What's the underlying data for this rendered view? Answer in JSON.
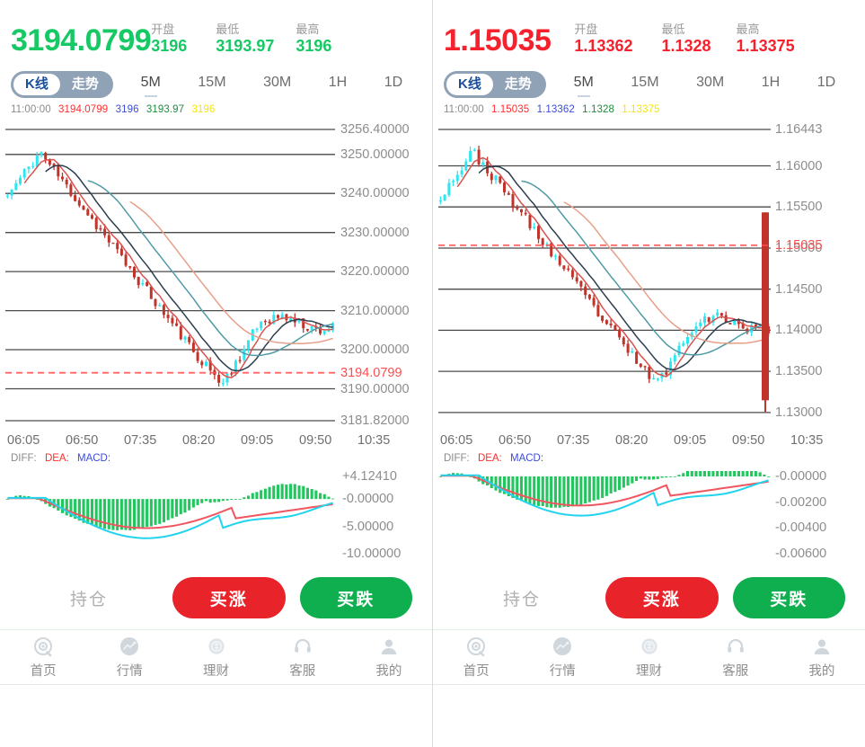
{
  "panels": [
    {
      "id": "left",
      "direction": "up",
      "last_price": "3194.0799",
      "stats": [
        {
          "label": "开盘",
          "value": "3196"
        },
        {
          "label": "最低",
          "value": "3193.97"
        },
        {
          "label": "最高",
          "value": "3196"
        }
      ],
      "segment": {
        "kline": "K线",
        "trend": "走势",
        "active": "K线"
      },
      "timeframes": [
        "5M",
        "15M",
        "30M",
        "1H",
        "1D"
      ],
      "active_timeframe": "5M",
      "ohlc": {
        "time": "11:00:00",
        "close": "3194.0799",
        "open": "3196",
        "low": "3193.97",
        "high": "3196"
      },
      "chart_data": {
        "type": "line",
        "title": "",
        "xlabel": "",
        "ylabel": "",
        "ylim": [
          3181.82,
          3256.4
        ],
        "ytick_labels": [
          "3256.40000",
          "3250.00000",
          "3240.00000",
          "3230.00000",
          "3220.00000",
          "3210.00000",
          "3200.00000",
          "3190.00000",
          "3181.82000"
        ],
        "ytick_values": [
          3256.4,
          3250.0,
          3240.0,
          3230.0,
          3220.0,
          3210.0,
          3200.0,
          3190.0,
          3181.82
        ],
        "current_price_line": {
          "value": "3194.0799",
          "color": "#ff4d4f",
          "style": "dashed"
        },
        "x_ticks": [
          "06:05",
          "06:50",
          "07:35",
          "08:20",
          "09:05",
          "09:50",
          "10:35"
        ],
        "grid": true,
        "legend": "none"
      },
      "macd": {
        "labels": {
          "diff": "DIFF:",
          "dea": "DEA:",
          "macd": "MACD:"
        },
        "ytick_labels": [
          "+4.12410",
          "-0.00000",
          "-5.00000",
          "-10.00000"
        ],
        "ytick_values": [
          4.1241,
          0.0,
          -5.0,
          -10.0
        ]
      },
      "actions": {
        "holding": "持仓",
        "buy_up": "买涨",
        "buy_down": "买跌"
      }
    },
    {
      "id": "right",
      "direction": "down",
      "last_price": "1.15035",
      "stats": [
        {
          "label": "开盘",
          "value": "1.13362"
        },
        {
          "label": "最低",
          "value": "1.1328"
        },
        {
          "label": "最高",
          "value": "1.13375"
        }
      ],
      "segment": {
        "kline": "K线",
        "trend": "走势",
        "active": "K线"
      },
      "timeframes": [
        "5M",
        "15M",
        "30M",
        "1H",
        "1D"
      ],
      "active_timeframe": "5M",
      "ohlc": {
        "time": "11:00:00",
        "close": "1.15035",
        "open": "1.13362",
        "low": "1.1328",
        "high": "1.13375"
      },
      "chart_data": {
        "type": "line",
        "title": "",
        "xlabel": "",
        "ylabel": "",
        "ylim": [
          1.129,
          1.16443
        ],
        "ytick_labels": [
          "1.16443",
          "1.16000",
          "1.15500",
          "1.15000",
          "1.14500",
          "1.14000",
          "1.13500",
          "1.13000"
        ],
        "ytick_values": [
          1.16443,
          1.16,
          1.155,
          1.15,
          1.145,
          1.14,
          1.135,
          1.13
        ],
        "current_price_line": {
          "value": "1.15035",
          "color": "#ff4d4f",
          "style": "dashed"
        },
        "x_ticks": [
          "06:05",
          "06:50",
          "07:35",
          "08:20",
          "09:05",
          "09:50",
          "10:35"
        ],
        "grid": true,
        "legend": "none"
      },
      "macd": {
        "labels": {
          "diff": "DIFF:",
          "dea": "DEA:",
          "macd": "MACD:"
        },
        "ytick_labels": [
          "-0.00000",
          "-0.00200",
          "-0.00400",
          "-0.00600"
        ],
        "ytick_values": [
          0.0,
          -0.002,
          -0.004,
          -0.006
        ]
      },
      "actions": {
        "holding": "持仓",
        "buy_up": "买涨",
        "buy_down": "买跌"
      }
    }
  ],
  "nav": [
    {
      "icon": "home-icon",
      "label": "首页"
    },
    {
      "icon": "market-trend-icon",
      "label": "行情"
    },
    {
      "icon": "finance-icon",
      "label": "理财"
    },
    {
      "icon": "headset-support-icon",
      "label": "客服"
    },
    {
      "icon": "user-profile-icon",
      "label": "我的"
    }
  ],
  "colors": {
    "up": "#17c964",
    "down": "#f5222d",
    "buy_up": "#e8232a",
    "buy_down": "#0fae4e",
    "candle_up": "#2ee6ef",
    "candle_down": "#c0342b",
    "macd_hist": "#22c55e"
  }
}
